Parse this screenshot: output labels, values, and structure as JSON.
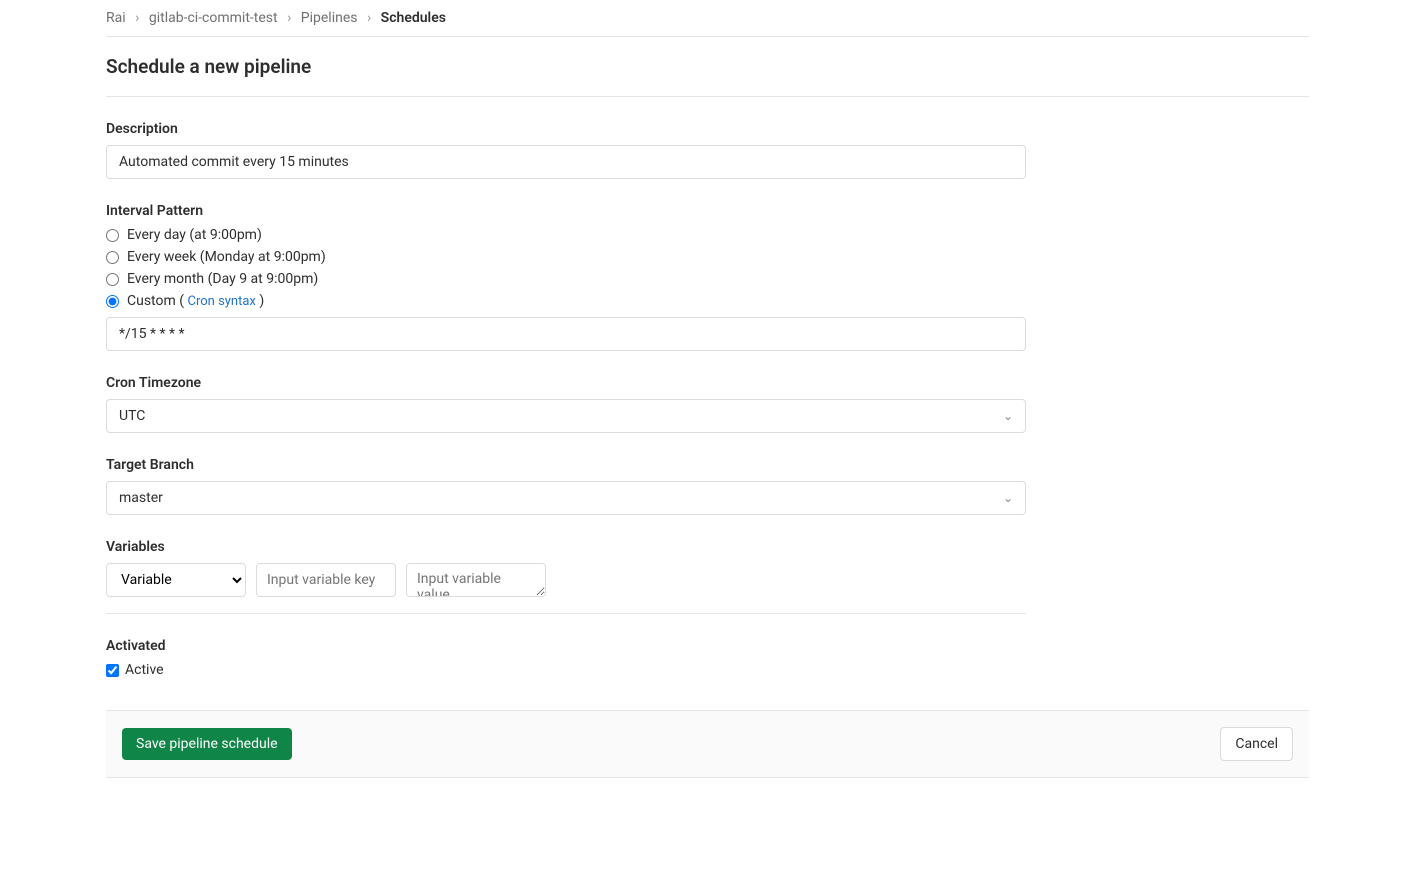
{
  "breadcrumb": {
    "items": [
      "Rai",
      "gitlab-ci-commit-test",
      "Pipelines"
    ],
    "current": "Schedules"
  },
  "page_title": "Schedule a new pipeline",
  "form": {
    "description": {
      "label": "Description",
      "value": "Automated commit every 15 minutes"
    },
    "interval": {
      "label": "Interval Pattern",
      "options": {
        "daily": "Every day (at 9:00pm)",
        "weekly": "Every week (Monday at 9:00pm)",
        "monthly": "Every month (Day 9 at 9:00pm)",
        "custom_prefix": "Custom (",
        "custom_link": "Cron syntax",
        "custom_suffix": ")"
      },
      "cron_value": "*/15 * * * *"
    },
    "timezone": {
      "label": "Cron Timezone",
      "value": "UTC"
    },
    "branch": {
      "label": "Target Branch",
      "value": "master"
    },
    "variables": {
      "label": "Variables",
      "type_value": "Variable",
      "key_placeholder": "Input variable key",
      "value_placeholder": "Input variable value"
    },
    "activated": {
      "label": "Activated",
      "checkbox_label": "Active",
      "checked": true
    }
  },
  "actions": {
    "save": "Save pipeline schedule",
    "cancel": "Cancel"
  }
}
